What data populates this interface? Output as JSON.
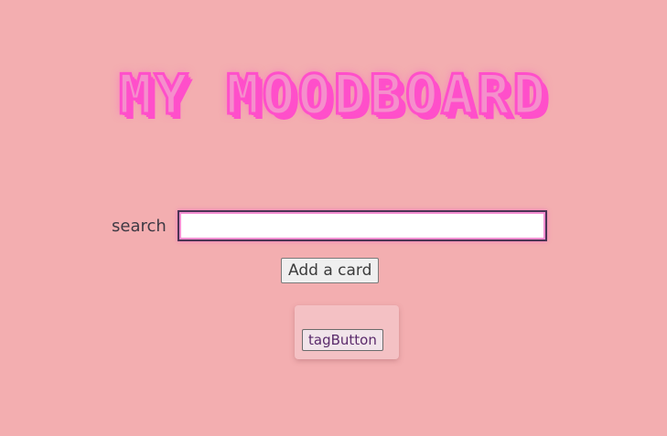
{
  "header": {
    "title": "MY MOODBOARD"
  },
  "search": {
    "label": "search",
    "value": "",
    "placeholder": ""
  },
  "actions": {
    "add_card_label": "Add a card"
  },
  "card": {
    "tag_button_label": "tagButton"
  },
  "colors": {
    "background": "#f3aeb0",
    "title_accent": "#ff4fca",
    "card_background": "#f4c1c4"
  }
}
